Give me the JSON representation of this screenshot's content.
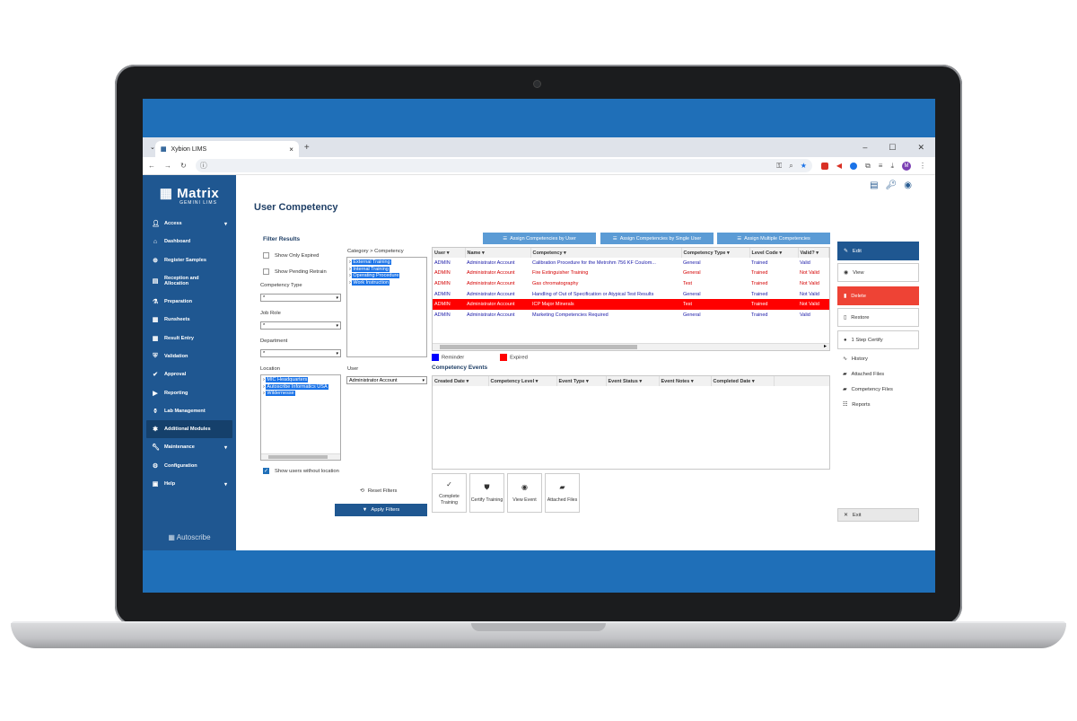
{
  "browser": {
    "tab_title": "Xybion LIMS",
    "tab_close": "×",
    "new_tab": "+",
    "win_min": "–",
    "win_max": "☐",
    "win_close": "✕",
    "avatar_letter": "M"
  },
  "app": {
    "logo_main": "Matrix",
    "logo_sub": "GEMINI LIMS",
    "footer": "Autoscribe",
    "page_title": "User Competency"
  },
  "sidebar": {
    "items": [
      {
        "label": "Access",
        "icon": "user-icon"
      },
      {
        "label": "Dashboard",
        "icon": "home-icon"
      },
      {
        "label": "Register Samples",
        "icon": "plus-circle-icon"
      },
      {
        "label": "Reception and Allocation",
        "icon": "clipboard-icon"
      },
      {
        "label": "Preparation",
        "icon": "flask-icon"
      },
      {
        "label": "Runsheets",
        "icon": "table-icon"
      },
      {
        "label": "Result Entry",
        "icon": "grid-icon"
      },
      {
        "label": "Validation",
        "icon": "shield-icon"
      },
      {
        "label": "Approval",
        "icon": "approval-icon"
      },
      {
        "label": "Reporting",
        "icon": "report-icon"
      },
      {
        "label": "Lab Management",
        "icon": "beaker-icon"
      },
      {
        "label": "Additional Modules",
        "icon": "puzzle-icon"
      },
      {
        "label": "Maintenance",
        "icon": "wrench-icon"
      },
      {
        "label": "Configuration",
        "icon": "gear-icon"
      },
      {
        "label": "Help",
        "icon": "help-icon"
      }
    ]
  },
  "filters": {
    "title": "Filter Results",
    "show_only_expired": "Show Only Expired",
    "show_pending_retrain": "Show Pending Retrain",
    "competency_type_label": "Competency Type",
    "competency_type_value": "*",
    "job_role_label": "Job Role",
    "job_role_value": "*",
    "department_label": "Department",
    "department_value": "*",
    "location_label": "Location",
    "locations": [
      "MIC Headquarters",
      "Autoscribe Informatics USA",
      "Wildernesse"
    ],
    "show_without_location": "Show users without location",
    "category_label": "Category > Competency",
    "categories": [
      "External Training",
      "Internal Training",
      "Operating Procedure",
      "Work Instruction"
    ],
    "user_label": "User",
    "user_value": "Administrator Account",
    "reset": "Reset Filters",
    "apply": "Apply Filters"
  },
  "toolbar": {
    "assign_by_user": "Assign Competencies by User",
    "assign_single_user": "Assign Competencies by Single User",
    "assign_multiple": "Assign Multiple Competencies"
  },
  "grid": {
    "columns": [
      "User",
      "Name",
      "Competency",
      "Competency Type",
      "Level Code",
      "Valid?"
    ],
    "rows": [
      {
        "user": "ADMIN",
        "name": "Administrator Account",
        "competency": "Calibration Procedure for the Metrohm 756 KF Coulom...",
        "type": "General",
        "level": "Trained",
        "valid": "Valid",
        "style": "blue"
      },
      {
        "user": "ADMIN",
        "name": "Administrator Account",
        "competency": "Fire Extinguisher Training",
        "type": "General",
        "level": "Trained",
        "valid": "Not Valid",
        "style": "red"
      },
      {
        "user": "ADMIN",
        "name": "Administrator Account",
        "competency": "Gas chromatography",
        "type": "Test",
        "level": "Trained",
        "valid": "Not Valid",
        "style": "red"
      },
      {
        "user": "ADMIN",
        "name": "Administrator Account",
        "competency": "Handling of Out of Specification or Atypical Test Results",
        "type": "General",
        "level": "Trained",
        "valid": "Not Valid",
        "style": "blue"
      },
      {
        "user": "ADMIN",
        "name": "Administrator Account",
        "competency": "ICP Major Minerals",
        "type": "Test",
        "level": "Trained",
        "valid": "Not Valid",
        "style": "exp"
      },
      {
        "user": "ADMIN",
        "name": "Administrator Account",
        "competency": "Marketing Competencies Required",
        "type": "General",
        "level": "Trained",
        "valid": "Valid",
        "style": "blue"
      }
    ]
  },
  "legend": {
    "reminder": "Reminder",
    "expired": "Expired",
    "reminder_color": "#0000ff",
    "expired_color": "#ff0000"
  },
  "events": {
    "title": "Competency Events",
    "columns": [
      "Created Date",
      "Competency Level",
      "Event Type",
      "Event Status",
      "Event Notes",
      "Completed Date"
    ],
    "buttons": [
      {
        "label": "Complete Training",
        "icon": "check-icon"
      },
      {
        "label": "Certify Training",
        "icon": "shield-icon"
      },
      {
        "label": "View Event",
        "icon": "eye-icon"
      },
      {
        "label": "Attached Files",
        "icon": "folder-icon"
      }
    ]
  },
  "actions": {
    "edit": "Edit",
    "view": "View",
    "delete": "Delete",
    "restore": "Restore",
    "step_certify": "1 Step Certify",
    "history": "History",
    "attached_files": "Attached Files",
    "competency_files": "Competency Files",
    "reports": "Reports",
    "exit": "Exit"
  }
}
